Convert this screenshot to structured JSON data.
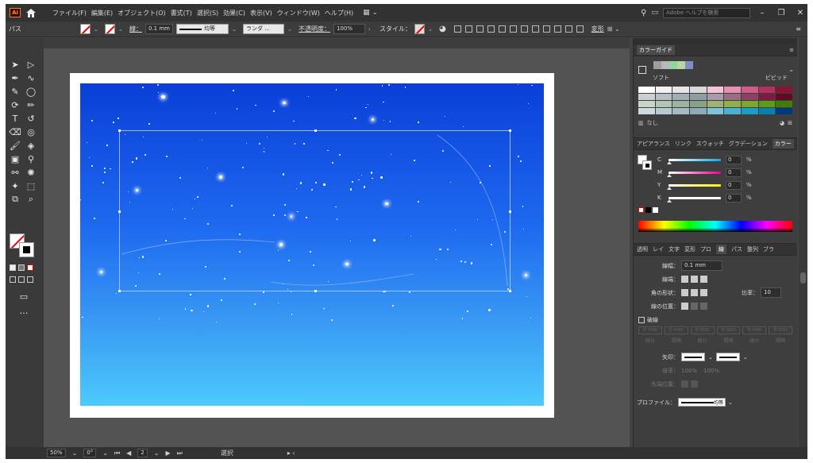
{
  "app": {
    "logo": "Ai"
  },
  "menu": [
    "ファイル(F)",
    "編集(E)",
    "オブジェクト(O)",
    "書式(T)",
    "選択(S)",
    "効果(C)",
    "表示(V)",
    "ウィンドウ(W)",
    "ヘルプ(H)"
  ],
  "menubar_right": {
    "search_placeholder": "Adobe ヘルプを検索"
  },
  "control": {
    "object_type": "パス",
    "stroke_label": "線：",
    "stroke_width": "0.1 mm",
    "profile": "均等",
    "brush": "ランダ ...",
    "opacity_label": "不透明度：",
    "opacity": "100%",
    "style_label": "スタイル：",
    "transform": "変形"
  },
  "color_guide": {
    "title": "カラーガイド",
    "soft": "ソフト",
    "vivid": "ビビッド",
    "none_label": "なし",
    "harmony": [
      "#9e9e9e",
      "#b8b8b8",
      "#8fd6a0",
      "#b9d6a0",
      "#7f8ec9"
    ],
    "grid": [
      "#ffffff",
      "#f2f2f2",
      "#e6e6e6",
      "#d9d9d9",
      "#f4c3d6",
      "#e88fb3",
      "#d05a8a",
      "#b5305e",
      "#8a1232",
      "#c8d0d4",
      "#b5bfc4",
      "#a2aeb4",
      "#8f9da4",
      "#a89aa8",
      "#9a6d86",
      "#8b4166",
      "#7a1c46",
      "#5e0b26",
      "#c9d5c9",
      "#b3c4b3",
      "#9db39d",
      "#87a287",
      "#9fb370",
      "#8fb04a",
      "#7aa82a",
      "#5e9a12",
      "#417d00",
      "#cddbe0",
      "#b9cbd2",
      "#a5bbc4",
      "#91abb6",
      "#7cc4d8",
      "#4ab2d0",
      "#1a9cc4",
      "#0a7fb0",
      "#003a7a"
    ]
  },
  "color_tabs": [
    "アピアランス",
    "リンク",
    "スウォッチ",
    "グラデーション",
    "カラー"
  ],
  "color": {
    "rows": [
      {
        "label": "C",
        "value": "0",
        "unit": "%",
        "color": "#00aeef"
      },
      {
        "label": "M",
        "value": "0",
        "unit": "%",
        "color": "#ec008c"
      },
      {
        "label": "Y",
        "value": "0",
        "unit": "%",
        "color": "#fff200"
      },
      {
        "label": "K",
        "value": "0",
        "unit": "%",
        "color": "#ffffff"
      }
    ]
  },
  "stroke_tabs": [
    "透明",
    "レイ",
    "文字",
    "変形",
    "プロ",
    "線",
    "パス",
    "整列",
    "ブラ"
  ],
  "stroke": {
    "width_label": "線幅：",
    "width": "0.1 mm",
    "cap_label": "線端：",
    "corner_label": "角の形状：",
    "limit_label": "比率：",
    "limit": "10",
    "align_label": "線の位置：",
    "dashed_label": "破線",
    "dash_cells": [
      {
        "value": "0 mm",
        "label": "線分"
      },
      {
        "value": "0 mm",
        "label": "間隔"
      },
      {
        "value": "0 mm",
        "label": "線分"
      },
      {
        "value": "0 mm",
        "label": "間隔"
      },
      {
        "value": "0 mm",
        "label": "線分"
      },
      {
        "value": "0 mm",
        "label": "間隔"
      }
    ],
    "arrow_label": "矢印：",
    "scale_label": "倍率：",
    "scale_a": "100%",
    "scale_b": "100%",
    "arrow_align_label": "先端位置：",
    "profile_label": "プロファイル：",
    "profile": "均等"
  },
  "status": {
    "zoom": "50%",
    "rotation": "0°",
    "artboard": "2",
    "tool": "選択"
  },
  "colors": {
    "sky_top": "#0a3fd8",
    "sky_bottom": "#4ccbfc"
  }
}
